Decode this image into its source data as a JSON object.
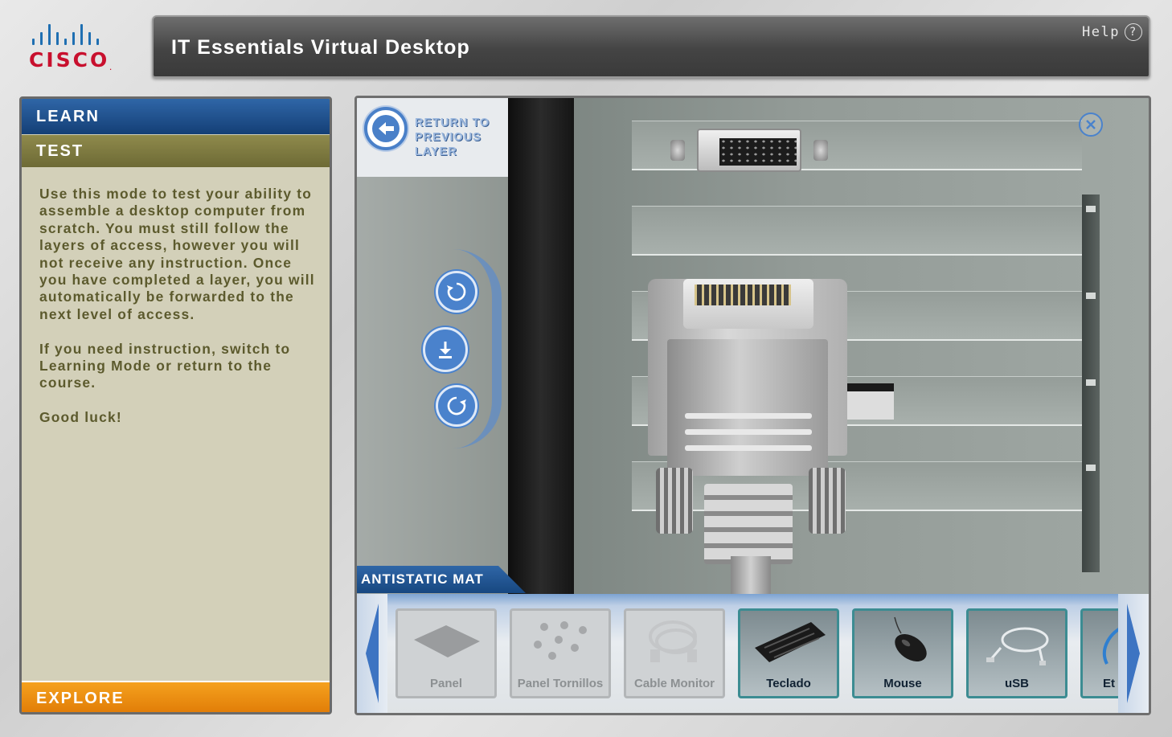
{
  "brand": {
    "logo_text": "CISCO",
    "colors": {
      "bars": "#1f6fb2",
      "word": "#c8102e"
    }
  },
  "header": {
    "title": "IT Essentials Virtual Desktop",
    "help_label": "Help",
    "help_icon": "question-circle-icon"
  },
  "left_panel": {
    "tabs": {
      "learn": "LEARN",
      "test": "TEST",
      "explore": "EXPLORE"
    },
    "paragraphs": [
      "Use this mode to test your ability to assemble a desktop computer from scratch. You must still follow the layers of access, however you will not receive any instruction. Once you have completed a layer, you will automatically be forwarded to the next level of access.",
      "If you need instruction, switch to Learning Mode or return to the course.",
      "Good luck!"
    ]
  },
  "viewport": {
    "return_label_line1": "RETURN TO",
    "return_label_line2": "PREVIOUS LAYER",
    "controls": [
      "rotate-left-icon",
      "download-icon",
      "rotate-right-icon"
    ],
    "close_icon": "close-icon",
    "location_label": "ANTISTATIC MAT"
  },
  "tray": {
    "items": [
      {
        "label": "Panel",
        "state": "disabled",
        "icon": "panel-icon"
      },
      {
        "label": "Panel Tornillos",
        "state": "disabled",
        "icon": "screws-icon"
      },
      {
        "label": "Cable Monitor",
        "state": "disabled",
        "icon": "cable-icon"
      },
      {
        "label": "Teclado",
        "state": "enabled",
        "icon": "keyboard-icon"
      },
      {
        "label": "Mouse",
        "state": "enabled",
        "icon": "mouse-icon"
      },
      {
        "label": "uSB",
        "state": "enabled",
        "icon": "usb-cable-icon"
      },
      {
        "label": "Et",
        "state": "enabled",
        "icon": "ethernet-cable-icon"
      }
    ]
  }
}
